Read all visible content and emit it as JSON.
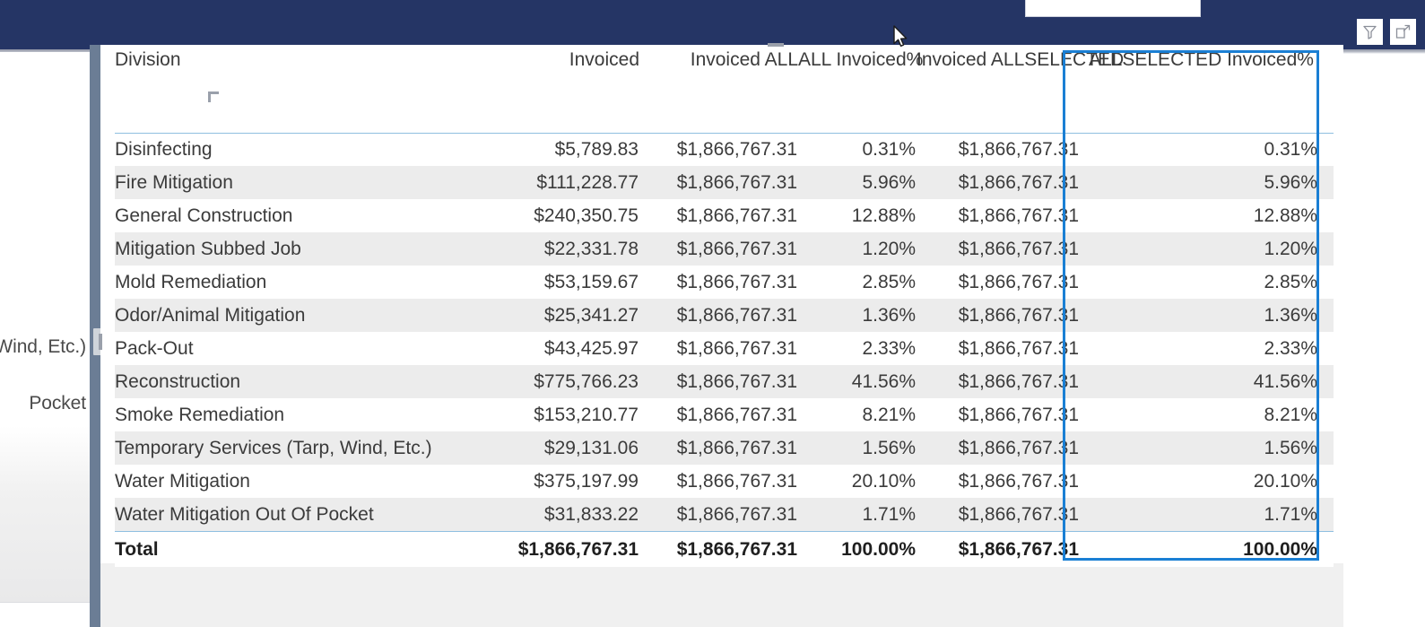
{
  "topbar": {
    "background_color": "#253565",
    "slicer_box": {
      "name": "slicer-search-box",
      "value": ""
    },
    "actions": [
      {
        "label": "Filter",
        "icon": "filter-icon"
      },
      {
        "label": "Focus mode",
        "icon": "focus-mode-icon"
      }
    ]
  },
  "left_panel": {
    "clipped_labels": [
      "Wind, Etc.)",
      "Pocket"
    ]
  },
  "table": {
    "highlight_color": "#1a7fd4",
    "header_rule_color": "#8fbfe0",
    "columns": [
      {
        "key": "division",
        "label": "Division",
        "align": "left"
      },
      {
        "key": "invoiced",
        "label": "Invoiced",
        "align": "right"
      },
      {
        "key": "invoiced_all",
        "label": "Invoiced ALL",
        "align": "right"
      },
      {
        "key": "all_invoiced_pct",
        "label": "ALL Invoiced%",
        "align": "right"
      },
      {
        "key": "invoiced_allselected",
        "label": "Invoiced ALLSELECTED",
        "align": "right"
      },
      {
        "key": "allselected_invoiced_pct",
        "label": "ALLSELECTED Invoiced%",
        "align": "right",
        "highlighted": true
      }
    ],
    "rows": [
      {
        "division": "Disinfecting",
        "invoiced": "$5,789.83",
        "invoiced_all": "$1,866,767.31",
        "all_invoiced_pct": "0.31%",
        "invoiced_allselected": "$1,866,767.31",
        "allselected_invoiced_pct": "0.31%"
      },
      {
        "division": "Fire Mitigation",
        "invoiced": "$111,228.77",
        "invoiced_all": "$1,866,767.31",
        "all_invoiced_pct": "5.96%",
        "invoiced_allselected": "$1,866,767.31",
        "allselected_invoiced_pct": "5.96%"
      },
      {
        "division": "General Construction",
        "invoiced": "$240,350.75",
        "invoiced_all": "$1,866,767.31",
        "all_invoiced_pct": "12.88%",
        "invoiced_allselected": "$1,866,767.31",
        "allselected_invoiced_pct": "12.88%"
      },
      {
        "division": "Mitigation Subbed Job",
        "invoiced": "$22,331.78",
        "invoiced_all": "$1,866,767.31",
        "all_invoiced_pct": "1.20%",
        "invoiced_allselected": "$1,866,767.31",
        "allselected_invoiced_pct": "1.20%"
      },
      {
        "division": "Mold Remediation",
        "invoiced": "$53,159.67",
        "invoiced_all": "$1,866,767.31",
        "all_invoiced_pct": "2.85%",
        "invoiced_allselected": "$1,866,767.31",
        "allselected_invoiced_pct": "2.85%"
      },
      {
        "division": "Odor/Animal Mitigation",
        "invoiced": "$25,341.27",
        "invoiced_all": "$1,866,767.31",
        "all_invoiced_pct": "1.36%",
        "invoiced_allselected": "$1,866,767.31",
        "allselected_invoiced_pct": "1.36%"
      },
      {
        "division": "Pack-Out",
        "invoiced": "$43,425.97",
        "invoiced_all": "$1,866,767.31",
        "all_invoiced_pct": "2.33%",
        "invoiced_allselected": "$1,866,767.31",
        "allselected_invoiced_pct": "2.33%"
      },
      {
        "division": "Reconstruction",
        "invoiced": "$775,766.23",
        "invoiced_all": "$1,866,767.31",
        "all_invoiced_pct": "41.56%",
        "invoiced_allselected": "$1,866,767.31",
        "allselected_invoiced_pct": "41.56%"
      },
      {
        "division": "Smoke Remediation",
        "invoiced": "$153,210.77",
        "invoiced_all": "$1,866,767.31",
        "all_invoiced_pct": "8.21%",
        "invoiced_allselected": "$1,866,767.31",
        "allselected_invoiced_pct": "8.21%"
      },
      {
        "division": "Temporary Services (Tarp, Wind, Etc.)",
        "invoiced": "$29,131.06",
        "invoiced_all": "$1,866,767.31",
        "all_invoiced_pct": "1.56%",
        "invoiced_allselected": "$1,866,767.31",
        "allselected_invoiced_pct": "1.56%"
      },
      {
        "division": "Water Mitigation",
        "invoiced": "$375,197.99",
        "invoiced_all": "$1,866,767.31",
        "all_invoiced_pct": "20.10%",
        "invoiced_allselected": "$1,866,767.31",
        "allselected_invoiced_pct": "20.10%"
      },
      {
        "division": "Water Mitigation Out Of Pocket",
        "invoiced": "$31,833.22",
        "invoiced_all": "$1,866,767.31",
        "all_invoiced_pct": "1.71%",
        "invoiced_allselected": "$1,866,767.31",
        "allselected_invoiced_pct": "1.71%"
      }
    ],
    "total": {
      "division": "Total",
      "invoiced": "$1,866,767.31",
      "invoiced_all": "$1,866,767.31",
      "all_invoiced_pct": "100.00%",
      "invoiced_allselected": "$1,866,767.31",
      "allselected_invoiced_pct": "100.00%"
    }
  }
}
